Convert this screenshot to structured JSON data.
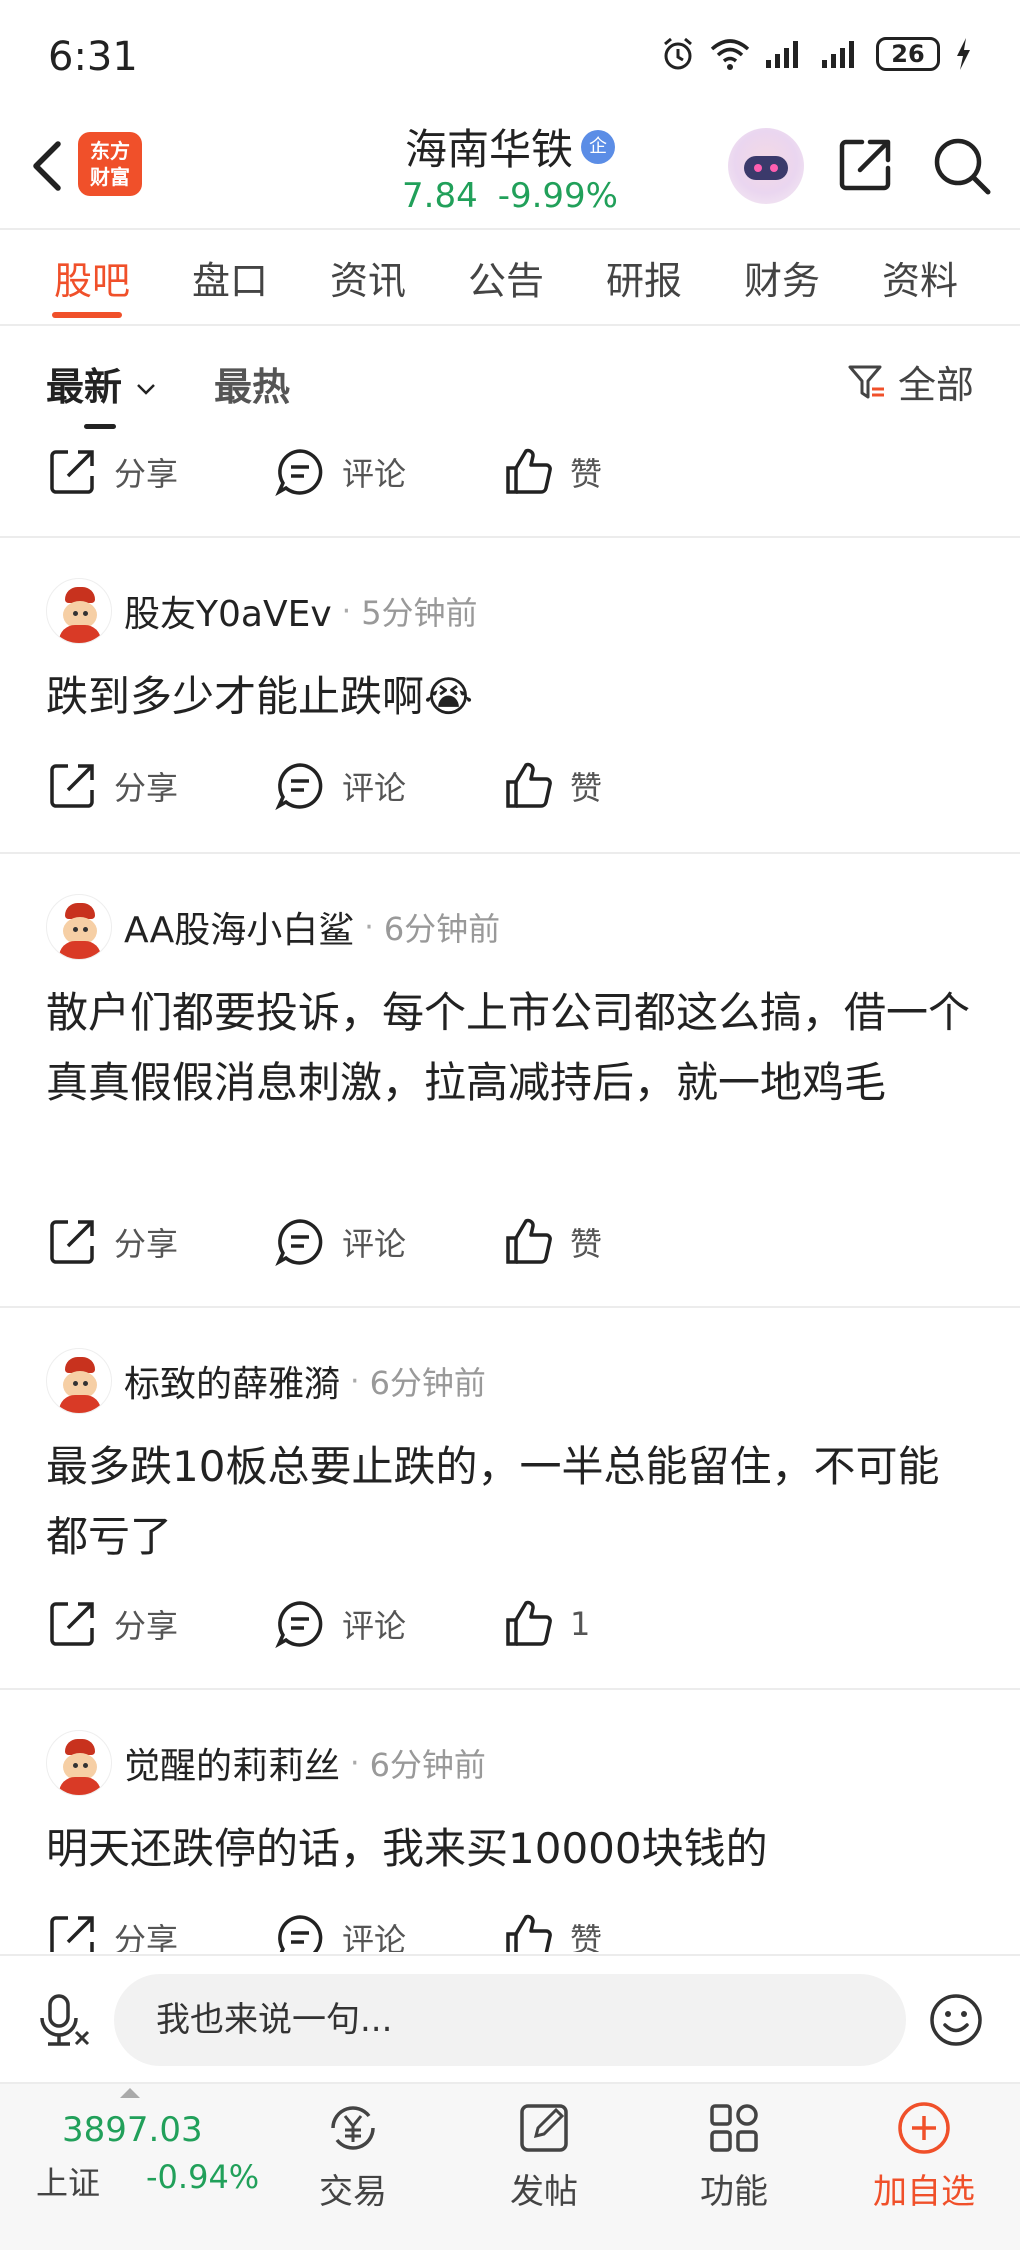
{
  "status_bar": {
    "time": "6:31",
    "battery": "26"
  },
  "header": {
    "logo_text_line1": "东方",
    "logo_text_line2": "财富",
    "stock_name": "海南华铁",
    "badge": "企",
    "price": "7.84",
    "change_pct": "-9.99%"
  },
  "tabs": [
    {
      "label": "股吧",
      "active": true
    },
    {
      "label": "盘口"
    },
    {
      "label": "资讯"
    },
    {
      "label": "公告"
    },
    {
      "label": "研报"
    },
    {
      "label": "财务"
    },
    {
      "label": "资料"
    }
  ],
  "filter": {
    "latest": "最新",
    "hot": "最热",
    "all": "全部"
  },
  "actions": {
    "share": "分享",
    "comment": "评论",
    "like": "赞"
  },
  "posts": [
    {
      "author": "股友Y0aVEv",
      "time": "5分钟前",
      "body": "跌到多少才能止跌啊😭",
      "likes": "赞"
    },
    {
      "author": "AA股海小白鲨",
      "time": "6分钟前",
      "body": "散户们都要投诉，每个上市公司都这么搞，借一个真真假假消息刺激，拉高减持后，就一地鸡毛",
      "likes": "赞"
    },
    {
      "author": "标致的薛雅漪",
      "time": "6分钟前",
      "body": "最多跌10板总要止跌的，一半总能留住，不可能都亏了",
      "likes": "1"
    },
    {
      "author": "觉醒的莉莉丝",
      "time": "6分钟前",
      "body": "明天还跌停的话，我来买10000块钱的",
      "likes": "赞"
    }
  ],
  "comment_bar": {
    "placeholder": "我也来说一句..."
  },
  "bottom_nav": {
    "index_value": "3897.03",
    "index_name": "上证",
    "index_change": "-0.94%",
    "items": [
      {
        "label": "交易",
        "icon": "yen-trade-icon"
      },
      {
        "label": "发帖",
        "icon": "compose-icon"
      },
      {
        "label": "功能",
        "icon": "grid-icon"
      },
      {
        "label": "加自选",
        "icon": "add-circle-icon"
      }
    ]
  },
  "colors": {
    "accent": "#f0502a",
    "down_green": "#21a05a",
    "badge_blue": "#5b8de6"
  }
}
